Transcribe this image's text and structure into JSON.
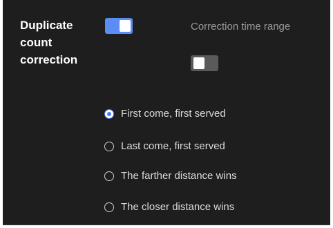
{
  "section": {
    "label_line1": "Duplicate",
    "label_line2": "count",
    "label_line3": "correction"
  },
  "duplicate_toggle": {
    "state": "on"
  },
  "time_range": {
    "label": "Correction time range",
    "state": "off"
  },
  "options": [
    {
      "label": "First come, first served",
      "selected": true
    },
    {
      "label": "Last come, first served",
      "selected": false
    },
    {
      "label": "The farther distance wins",
      "selected": false
    },
    {
      "label": "The closer distance wins",
      "selected": false
    }
  ],
  "colors": {
    "panel_bg": "#1e1e1e",
    "accent": "#5b8df5",
    "toggle_off": "#5a5a5a"
  }
}
